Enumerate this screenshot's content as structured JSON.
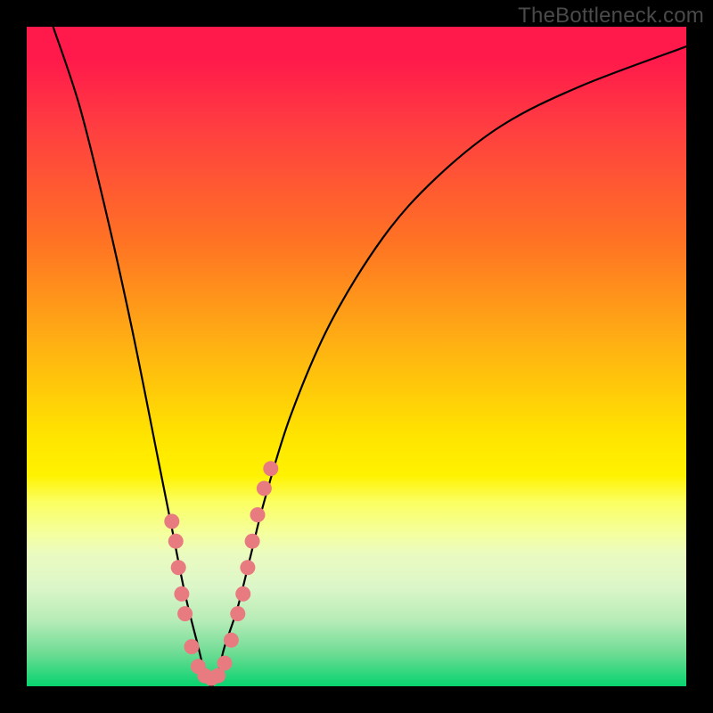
{
  "watermark": "TheBottleneck.com",
  "chart_data": {
    "type": "line",
    "title": "",
    "xlabel": "",
    "ylabel": "",
    "xlim": [
      0,
      100
    ],
    "ylim": [
      0,
      100
    ],
    "gradient_meaning": "bottleneck severity (top red = high, bottom green = low)",
    "series": [
      {
        "name": "bottleneck-curve",
        "x": [
          4,
          8,
          12,
          16,
          20,
          22,
          24,
          26,
          27,
          28,
          29,
          30,
          32,
          34,
          36,
          40,
          46,
          54,
          62,
          72,
          84,
          100
        ],
        "y": [
          100,
          88,
          72,
          54,
          34,
          24,
          14,
          6,
          2,
          0,
          2,
          6,
          12,
          20,
          28,
          41,
          55,
          68,
          77,
          85,
          91,
          97
        ]
      }
    ],
    "annotations": [
      {
        "name": "beads-cluster",
        "description": "pink round markers clustered along the lower part of the V, roughly y<30",
        "points_xy": [
          [
            22,
            25
          ],
          [
            22.6,
            22
          ],
          [
            23,
            18
          ],
          [
            23.5,
            14
          ],
          [
            24,
            11
          ],
          [
            25,
            6
          ],
          [
            26,
            3
          ],
          [
            27,
            1.6
          ],
          [
            28,
            1.2
          ],
          [
            29,
            1.6
          ],
          [
            30,
            3.5
          ],
          [
            31,
            7
          ],
          [
            32,
            11
          ],
          [
            32.8,
            14
          ],
          [
            33.5,
            18
          ],
          [
            34.2,
            22
          ],
          [
            35,
            26
          ],
          [
            36,
            30
          ],
          [
            37,
            33
          ]
        ]
      }
    ]
  }
}
